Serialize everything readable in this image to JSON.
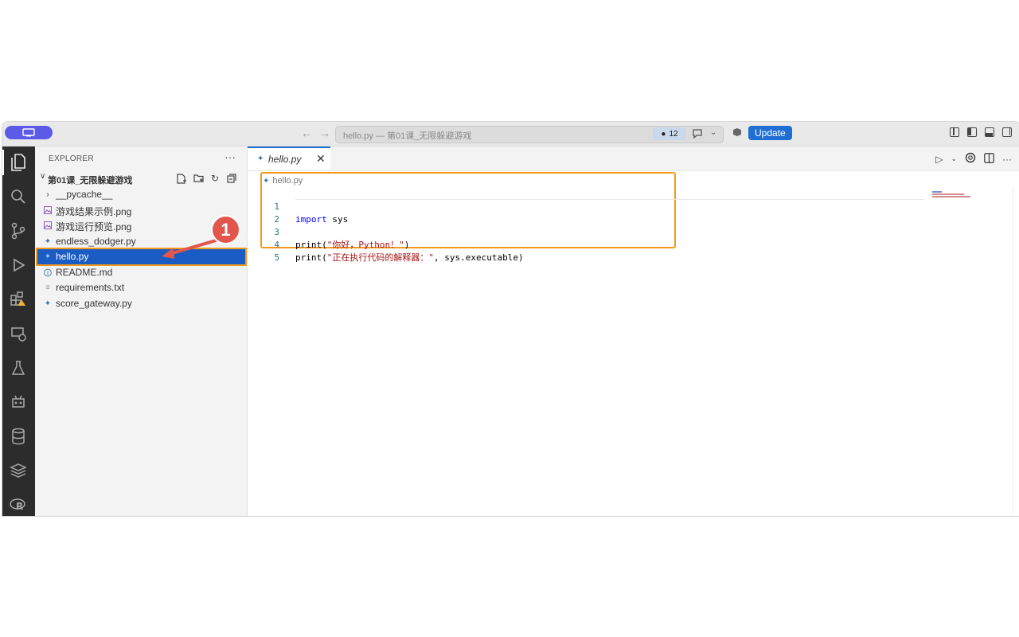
{
  "titlebar": {
    "window_title": "hello.py — 第01课_无限躲避游戏",
    "problems_count": "12",
    "update_label": "Update",
    "nav_back_icon": "arrow-left-icon",
    "nav_forward_icon": "arrow-right-icon"
  },
  "sidebar": {
    "title": "EXPLORER",
    "more": "···",
    "folder": "第01课_无限躲避游戏",
    "files": [
      {
        "name": "__pycache__",
        "kind": "folder",
        "icon": "chevron-right-icon"
      },
      {
        "name": "游戏结果示例.png",
        "kind": "image",
        "icon": "image-icon"
      },
      {
        "name": "游戏运行预览.png",
        "kind": "image",
        "icon": "image-icon"
      },
      {
        "name": "endless_dodger.py",
        "kind": "python",
        "icon": "python-icon"
      },
      {
        "name": "hello.py",
        "kind": "python",
        "icon": "python-icon",
        "selected": true
      },
      {
        "name": "README.md",
        "kind": "markdown",
        "icon": "info-icon"
      },
      {
        "name": "requirements.txt",
        "kind": "text",
        "icon": "lines-icon"
      },
      {
        "name": "score_gateway.py",
        "kind": "python",
        "icon": "python-icon"
      }
    ]
  },
  "annotation": {
    "step": "1"
  },
  "editor": {
    "tab_label": "hello.py",
    "tab_close": "✕",
    "breadcrumb": "hello.py",
    "lines": [
      {
        "num": "1",
        "code": "import sys"
      },
      {
        "num": "2",
        "code": ""
      },
      {
        "num": "3",
        "code": "print(\"你好，Python！\")"
      },
      {
        "num": "4",
        "code": "print(\"正在执行代码的解释器：\", sys.executable)"
      },
      {
        "num": "5",
        "code": ""
      }
    ]
  },
  "colors": {
    "accent": "#1f6ed4",
    "selection": "#1a5bc4",
    "highlight": "#f39a1d",
    "annotation": "#e2574c",
    "activity_bar": "#2c2c2c"
  }
}
